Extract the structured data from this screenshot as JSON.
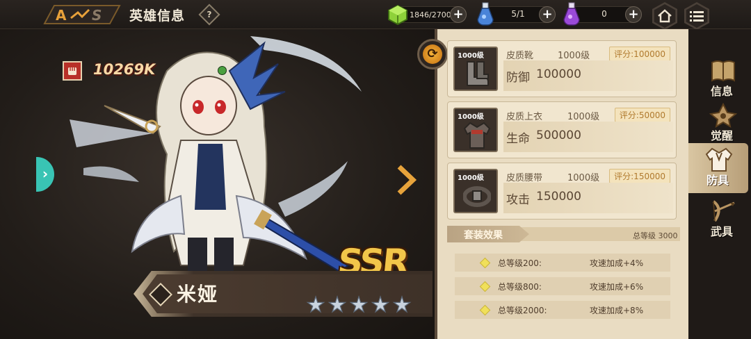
{
  "header": {
    "title": "英雄信息",
    "help_label": "?"
  },
  "resources": {
    "stamina": "1846/2700",
    "potion": "5/1",
    "elixir": "0"
  },
  "hero": {
    "power": "10269K",
    "rarity": "SSR",
    "name": "米娅",
    "stars": 5
  },
  "equipment": [
    {
      "level_badge": "1000级",
      "name": "皮质靴",
      "level": "1000级",
      "score": "评分:100000",
      "stat_name": "防御",
      "stat_value": "100000"
    },
    {
      "level_badge": "1000级",
      "name": "皮质上衣",
      "level": "1000级",
      "score": "评分:50000",
      "stat_name": "生命",
      "stat_value": "500000"
    },
    {
      "level_badge": "1000级",
      "name": "皮质腰带",
      "level": "1000级",
      "score": "评分:150000",
      "stat_name": "攻击",
      "stat_value": "150000"
    }
  ],
  "set_bonus": {
    "title": "套装效果",
    "total": "总等级 3000",
    "tiers": [
      {
        "requirement": "总等级200:",
        "effect": "攻速加成+4%"
      },
      {
        "requirement": "总等级800:",
        "effect": "攻速加成+6%"
      },
      {
        "requirement": "总等级2000:",
        "effect": "攻速加成+8%"
      }
    ]
  },
  "side_tabs": [
    {
      "label": "信息",
      "icon": "book-icon",
      "active": false
    },
    {
      "label": "觉醒",
      "icon": "awaken-icon",
      "active": false
    },
    {
      "label": "防具",
      "icon": "armor-icon",
      "active": true
    },
    {
      "label": "武具",
      "icon": "weapon-icon",
      "active": false
    }
  ],
  "colors": {
    "accent_gold": "#f2c64a",
    "panel_bg": "#e9dcc2",
    "score_text": "#b07a2e",
    "teal_arrow": "#39c4b4"
  }
}
